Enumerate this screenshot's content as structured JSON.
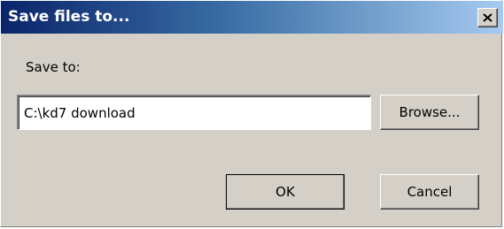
{
  "window": {
    "title": "Save files to...",
    "close_icon": "close-icon"
  },
  "form": {
    "label": "Save to:",
    "path_value": "C:\\kd7 download",
    "browse_label": "Browse..."
  },
  "actions": {
    "ok_label": "OK",
    "cancel_label": "Cancel"
  },
  "colors": {
    "titlebar_start": "#0a246a",
    "titlebar_end": "#a6caf0",
    "dialog_bg": "#d4d0c8"
  }
}
